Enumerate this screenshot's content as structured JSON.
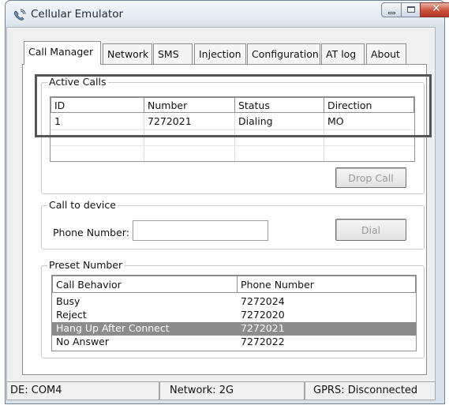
{
  "window": {
    "title": "Cellular Emulator"
  },
  "tabs": [
    {
      "label": "Call Manager"
    },
    {
      "label": "Network"
    },
    {
      "label": "SMS"
    },
    {
      "label": "Injection"
    },
    {
      "label": "Configuration"
    },
    {
      "label": "AT log"
    },
    {
      "label": "About"
    }
  ],
  "active_calls": {
    "group_label": "Active Calls",
    "columns": [
      "ID",
      "Number",
      "Status",
      "Direction"
    ],
    "rows": [
      [
        "1",
        "7272021",
        "Dialing",
        "MO"
      ]
    ],
    "drop_button": "Drop Call"
  },
  "call_to_device": {
    "group_label": "Call to device",
    "phone_label": "Phone Number:",
    "phone_value": "",
    "dial_button": "Dial"
  },
  "preset": {
    "group_label": "Preset Number",
    "columns": [
      "Call Behavior",
      "Phone Number"
    ],
    "rows": [
      [
        "Busy",
        "7272024"
      ],
      [
        "Reject",
        "7272020"
      ],
      [
        "Hang Up After Connect",
        "7272021"
      ],
      [
        "No Answer",
        "7272022"
      ]
    ],
    "selected_row": 2
  },
  "status_bar": {
    "device": "DE: COM4",
    "network": "Network: 2G",
    "gprs": "GPRS: Disconnected"
  },
  "colors": {
    "selection": "#8c8c8c",
    "highlight_border": "#555555"
  }
}
